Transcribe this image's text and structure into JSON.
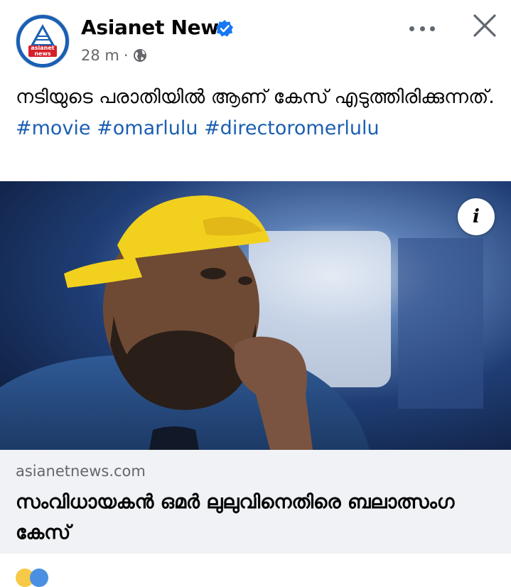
{
  "post": {
    "page_name": "Asianet News",
    "timestamp": "28 m",
    "separator": "·",
    "privacy_icon": "globe-icon",
    "verified_icon": "verified-badge-icon",
    "text_plain": "നടിയുടെ പരാതിയിൽ ആണ് കേസ് എടുത്തിരിക്കുന്നത്.",
    "hashtags": [
      "#movie",
      "#omarlulu",
      "#directoromerlulu"
    ]
  },
  "logo": {
    "brand_top": "asianet",
    "brand_bottom": "news"
  },
  "link": {
    "domain": "asianetnews.com",
    "title": "സംവിധായകൻ ഒമർ ലുലുവിനെതിരെ ബലാത്സംഗ കേസ്",
    "info_label": "i"
  },
  "colors": {
    "hashtag": "#1b5fb3",
    "verified": "#1877f2",
    "preview_bg": "#f0f2f5",
    "brand_red": "#d6202a",
    "brand_blue": "#1a5fb4"
  }
}
